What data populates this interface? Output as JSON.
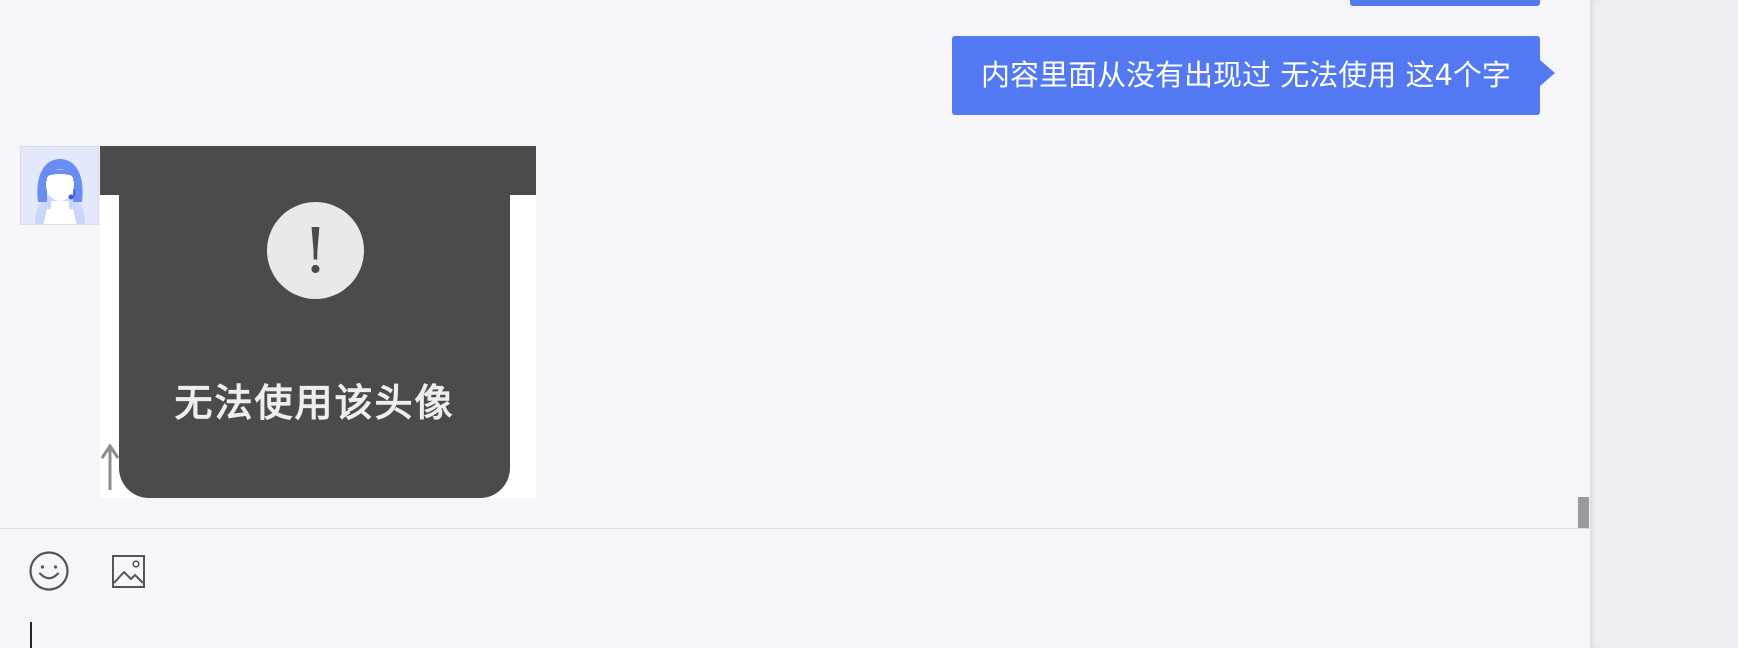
{
  "conversation": {
    "sent_message": "内容里面从没有出现过 无法使用 这4个字",
    "received_image": {
      "caption": "无法使用该头像",
      "warning_symbol": "!"
    }
  },
  "composer": {
    "emoji_icon": "smiley-face-icon",
    "image_icon": "picture-icon",
    "input_value": ""
  },
  "colors": {
    "bubble": "#5278f2",
    "panel_bg": "#f6f6fa",
    "image_bg": "#4b4b4b"
  }
}
